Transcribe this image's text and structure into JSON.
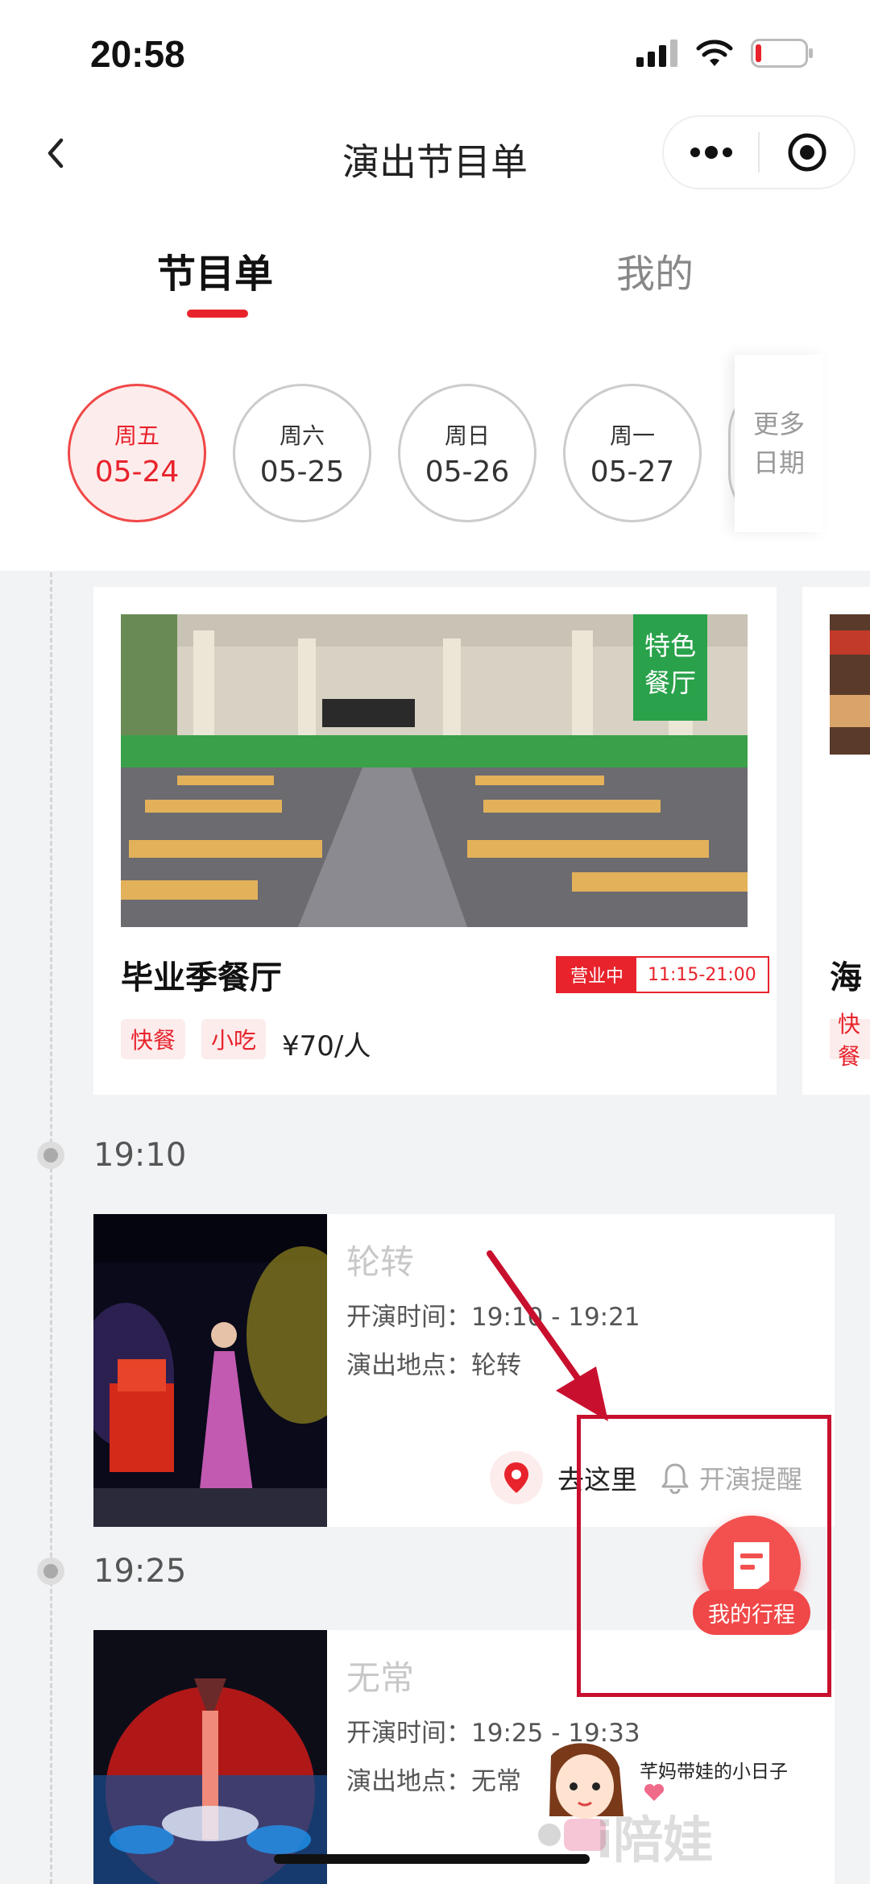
{
  "status_bar": {
    "time": "20:58"
  },
  "nav": {
    "title": "演出节目单"
  },
  "tabs": [
    {
      "label": "节目单",
      "active": true
    },
    {
      "label": "我的",
      "active": false
    }
  ],
  "dates": [
    {
      "weekday": "周五",
      "date": "05-24",
      "active": true
    },
    {
      "weekday": "周六",
      "date": "05-25",
      "active": false
    },
    {
      "weekday": "周日",
      "date": "05-26",
      "active": false
    },
    {
      "weekday": "周一",
      "date": "05-27",
      "active": false
    }
  ],
  "more_dates": {
    "line1": "更多",
    "line2": "日期"
  },
  "restaurant": {
    "badge_line1": "特色",
    "badge_line2": "餐厅",
    "name": "毕业季餐厅",
    "status": "营业中",
    "hours": "11:15-21:00",
    "tags": [
      "快餐",
      "小吃"
    ],
    "price": "¥70/人"
  },
  "restaurant_peek": {
    "name_partial": "海",
    "tag_partial": "快餐"
  },
  "shows": [
    {
      "time": "19:10",
      "title": "轮转",
      "time_line": "开演时间：19:10 - 19:21",
      "venue_line": "演出地点：轮转",
      "go_label": "去这里",
      "remind_label": "开演提醒"
    },
    {
      "time": "19:25",
      "title": "无常",
      "time_line": "开演时间：19:25 - 19:33",
      "venue_line": "演出地点：无常"
    }
  ],
  "fab": {
    "label": "我的行程"
  },
  "watermark": {
    "caption": "芊妈带娃的小日子",
    "brand": "i陪娃"
  },
  "colors": {
    "accent": "#e8232c",
    "feature_green": "#2aa24b",
    "highlight_box": "#c8102e",
    "content_bg": "#f2f3f5"
  }
}
